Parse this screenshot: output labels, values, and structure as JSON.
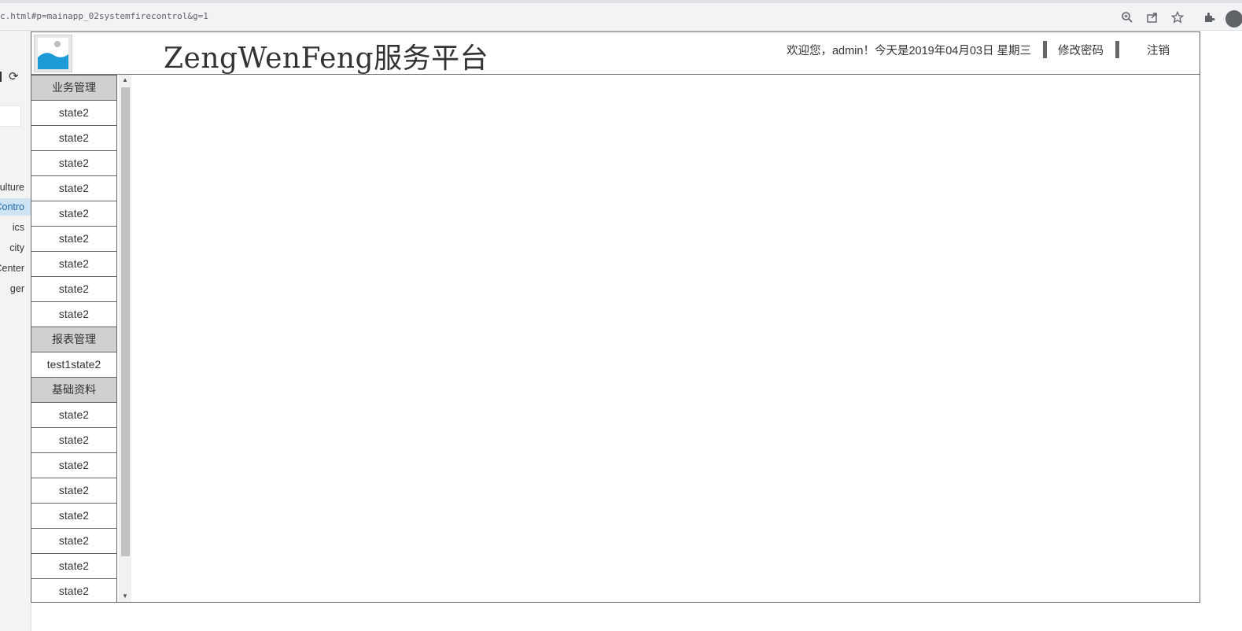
{
  "browser": {
    "url": "c.html#p=mainapp_02systemfirecontrol&g=1",
    "icons": [
      "zoom-icon",
      "share-icon",
      "star-icon",
      "extensions-icon",
      "profile-icon"
    ]
  },
  "left_panel": {
    "items": [
      "ulture",
      "Contro",
      "ics",
      "city",
      "Center",
      "ger"
    ],
    "active_index": 1
  },
  "header": {
    "title": "ZengWenFeng服务平台",
    "welcome": "欢迎您，admin！今天是2019年04月03日 星期三",
    "change_password": "修改密码",
    "logout": "注销"
  },
  "menu": {
    "group1": "业务管理",
    "group1_items": [
      "state2",
      "state2",
      "state2",
      "state2",
      "state2",
      "state2",
      "state2",
      "state2",
      "state2"
    ],
    "group2": "报表管理",
    "group2_items": [
      "test1state2"
    ],
    "group3": "基础资料",
    "group3_items": [
      "state2",
      "state2",
      "state2",
      "state2",
      "state2",
      "state2",
      "state2",
      "state2"
    ]
  },
  "colors": {
    "logo_blue": "#1d9bd7",
    "group_bg": "#d0d0d0",
    "active_left": "#cfe4f3"
  }
}
